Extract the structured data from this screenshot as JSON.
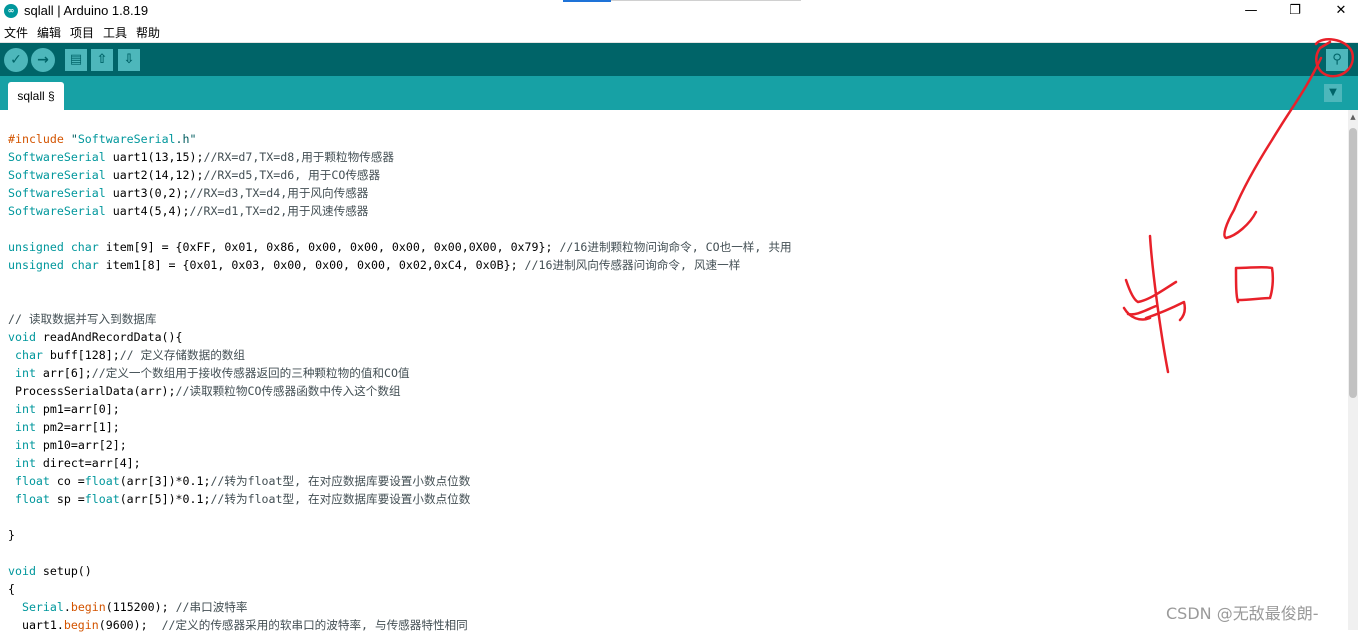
{
  "window": {
    "title": "sqlall | Arduino 1.8.19",
    "app_icon": "arduino-logo-icon",
    "controls": {
      "minimize": "—",
      "maximize": "❐",
      "close": "✕"
    }
  },
  "menu": {
    "items": [
      "文件",
      "编辑",
      "项目",
      "工具",
      "帮助"
    ]
  },
  "toolbar": {
    "buttons": [
      {
        "name": "verify-button",
        "icon": "check-icon",
        "glyph": "✓"
      },
      {
        "name": "upload-button",
        "icon": "arrow-right-icon",
        "glyph": "→"
      },
      {
        "name": "new-button",
        "icon": "new-file-icon",
        "glyph": "▤"
      },
      {
        "name": "open-button",
        "icon": "arrow-up-icon",
        "glyph": "⇧"
      },
      {
        "name": "save-button",
        "icon": "arrow-down-icon",
        "glyph": "⇩"
      }
    ],
    "serial_monitor": {
      "icon": "magnifier-icon",
      "glyph": "⚲"
    }
  },
  "tabs": {
    "active": "sqlall §",
    "menu_glyph": "▼"
  },
  "colors": {
    "toolbar_bg": "#006468",
    "tabbar_bg": "#17a1a5",
    "keyword": "#d35400",
    "type": "#00979c",
    "comment": "#434f54",
    "annotation": "#e8212a"
  },
  "code": {
    "lines": [
      "#include \"SoftwareSerial.h\"",
      "SoftwareSerial uart1(13,15);//RX=d7,TX=d8,用于颗粒物传感器",
      "SoftwareSerial uart2(14,12);//RX=d5,TX=d6, 用于CO传感器",
      "SoftwareSerial uart3(0,2);//RX=d3,TX=d4,用于风向传感器",
      "SoftwareSerial uart4(5,4);//RX=d1,TX=d2,用于风速传感器",
      "",
      "unsigned char item[9] = {0xFF, 0x01, 0x86, 0x00, 0x00, 0x00, 0x00,0X00, 0x79}; //16进制颗粒物问询命令, CO也一样, 共用",
      "unsigned char item1[8] = {0x01, 0x03, 0x00, 0x00, 0x00, 0x02,0xC4, 0x0B}; //16进制风向传感器问询命令, 风速一样",
      "",
      "",
      "// 读取数据并写入到数据库",
      "void readAndRecordData(){",
      " char buff[128];// 定义存储数据的数组",
      " int arr[6];//定义一个数组用于接收传感器返回的三种颗粒物的值和CO值",
      " ProcessSerialData(arr);//读取颗粒物CO传感器函数中传入这个数组",
      " int pm1=arr[0];",
      " int pm2=arr[1];",
      " int pm10=arr[2];",
      " int direct=arr[4];",
      " float co =float(arr[3])*0.1;//转为float型, 在对应数据库要设置小数点位数",
      " float sp =float(arr[5])*0.1;//转为float型, 在对应数据库要设置小数点位数",
      "",
      "}",
      "",
      "void setup()",
      "{",
      "  Serial.begin(115200); //串口波特率",
      "  uart1.begin(9600);  //定义的传感器采用的软串口的波特率, 与传感器特性相同"
    ]
  },
  "annotation": {
    "handwritten_text": "串口"
  },
  "watermark": "CSDN @无敌最俊朗-"
}
